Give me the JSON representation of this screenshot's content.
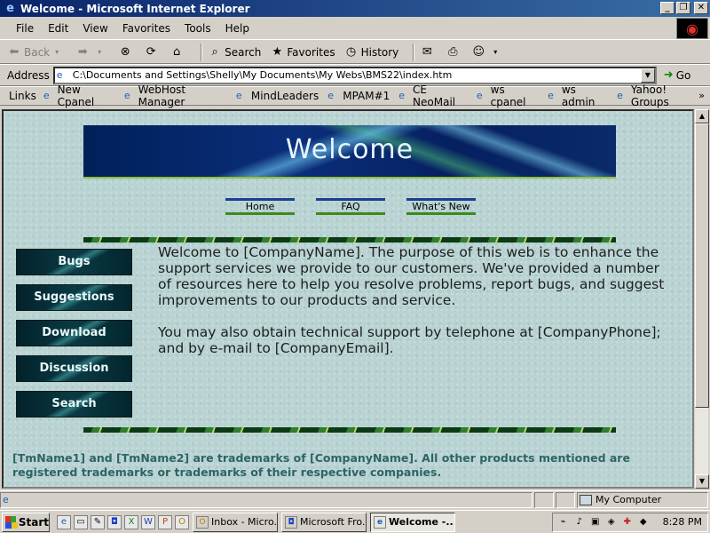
{
  "window": {
    "title": "Welcome - Microsoft Internet Explorer",
    "minimize": "_",
    "maximize": "❐",
    "close": "✕"
  },
  "menu": [
    "File",
    "Edit",
    "View",
    "Favorites",
    "Tools",
    "Help"
  ],
  "toolbar": {
    "back": "Back",
    "search": "Search",
    "favorites": "Favorites",
    "history": "History"
  },
  "address": {
    "label": "Address",
    "value": "C:\\Documents and Settings\\Shelly\\My Documents\\My Webs\\BMS22\\index.htm",
    "go": "Go"
  },
  "links": {
    "label": "Links",
    "items": [
      "New Cpanel",
      "WebHost Manager",
      "MindLeaders",
      "MPAM#1",
      "CE NeoMail",
      "ws cpanel",
      "ws admin",
      "Yahoo! Groups"
    ],
    "more": "»"
  },
  "page": {
    "banner": "Welcome",
    "topnav": [
      "Home",
      "FAQ",
      "What's New"
    ],
    "sidenav": [
      "Bugs",
      "Suggestions",
      "Download",
      "Discussion",
      "Search"
    ],
    "para1": "Welcome to [CompanyName]. The purpose of this web is to enhance the support services we provide to our customers. We've provided a number of resources here to help you resolve problems, report bugs, and suggest improvements to our products and service.",
    "para2": "You may also obtain technical support by telephone at [CompanyPhone]; and by e-mail to [CompanyEmail].",
    "footer": "[TmName1] and [TmName2] are trademarks of [CompanyName]. All other products mentioned are registered trademarks or trademarks of their respective companies."
  },
  "status": {
    "zone": "My Computer"
  },
  "taskbar": {
    "start": "Start",
    "tasks": [
      "Inbox - Micro...",
      "Microsoft Fro...",
      "Welcome -..."
    ],
    "clock": "8:28 PM"
  }
}
